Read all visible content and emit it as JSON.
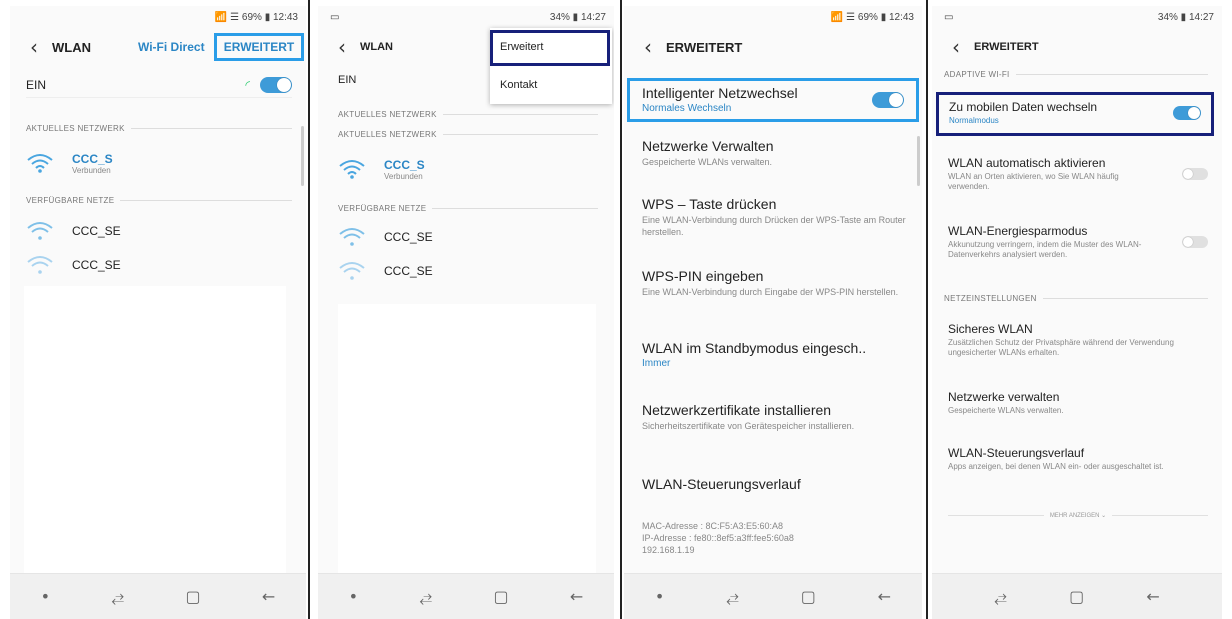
{
  "panel1": {
    "status": "📶 ☰ 69% ▮ 12:43",
    "title": "WLAN",
    "wifi_direct": "Wi-Fi Direct",
    "erweitert": "ERWEITERT",
    "toggle_label": "EIN",
    "section_current": "AKTUELLES NETZWERK",
    "current_net": "CCC_S",
    "current_status": "Verbunden",
    "section_available": "VERFÜGBARE NETZE",
    "available": [
      "CCC_SE",
      "CCC_SE"
    ]
  },
  "panel2": {
    "status": "34% ▮ 14:27",
    "title": "WLAN",
    "toggle_label": "EIN",
    "section_current": "AKTUELLES NETZWERK",
    "section_current2": "AKTUELLES NETZWERK",
    "current_net": "CCC_S",
    "current_status": "Verbunden",
    "section_available": "VERFÜGBARE NETZE",
    "available": [
      "CCC_SE",
      "CCC_SE"
    ],
    "menu": [
      "Erweitert",
      "Kontakt"
    ]
  },
  "panel3": {
    "status": "📶 ☰ 69% ▮ 12:43",
    "title": "ERWEITERT",
    "items": [
      {
        "title": "Intelligenter Netzwechsel",
        "sub": "Normales Wechseln"
      },
      {
        "title": "Netzwerke Verwalten",
        "sub": "Gespeicherte WLANs verwalten."
      },
      {
        "title": "WPS – Taste drücken",
        "sub": "Eine WLAN-Verbindung durch Drücken der WPS-Taste am Router herstellen."
      },
      {
        "title": "WPS-PIN eingeben",
        "sub": "Eine WLAN-Verbindung durch Eingabe der WPS-PIN herstellen."
      },
      {
        "title": "WLAN im Standbymodus eingesch..",
        "sub": "Immer"
      },
      {
        "title": "Netzwerkzertifikate installieren",
        "sub": "Sicherheitszertifikate von Gerätespeicher installieren."
      },
      {
        "title": "WLAN-Steuerungsverlauf",
        "sub": ""
      }
    ],
    "mac": "MAC-Adresse : 8C:F5:A3:E5:60:A8",
    "ip": "IP-Adresse : fe80::8ef5:a3ff:fee5:60a8",
    "ip4": "192.168.1.19"
  },
  "panel4": {
    "status": "34% ▮ 14:27",
    "title": "ERWEITERT",
    "section_adaptive": "ADAPTIVE WI-FI",
    "items_adaptive": [
      {
        "title": "Zu mobilen Daten wechseln",
        "sub": "Normalmodus"
      },
      {
        "title": "WLAN automatisch aktivieren",
        "sub": "WLAN an Orten aktivieren, wo Sie WLAN häufig verwenden."
      },
      {
        "title": "WLAN-Energiesparmodus",
        "sub": "Akkunutzung verringern, indem die Muster des WLAN-Datenverkehrs analysiert werden."
      }
    ],
    "section_net": "NETZEINSTELLUNGEN",
    "items_net": [
      {
        "title": "Sicheres WLAN",
        "sub": "Zusätzlichen Schutz der Privatsphäre während der Verwendung ungesicherter WLANs erhalten."
      },
      {
        "title": "Netzwerke verwalten",
        "sub": "Gespeicherte WLANs verwalten."
      },
      {
        "title": "WLAN-Steuerungsverlauf",
        "sub": "Apps anzeigen, bei denen WLAN ein- oder ausgeschaltet ist."
      }
    ],
    "more": "MEHR ANZEIGEN ⌄"
  },
  "nav": {
    "dot": "•",
    "recent": "⥄",
    "home": "▢",
    "back": "←"
  },
  "colors": {
    "accent": "#3e9bd8",
    "highlight_blue": "#2a9de8",
    "highlight_navy": "#17207a"
  }
}
